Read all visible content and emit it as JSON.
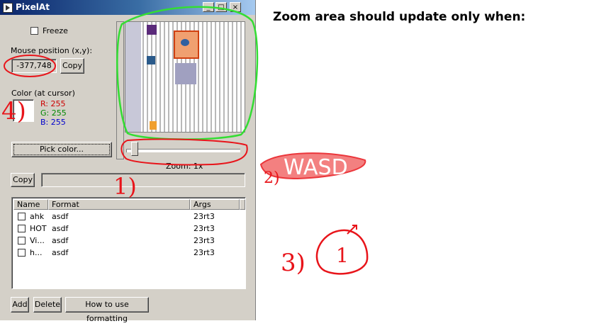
{
  "window": {
    "title": "PixelAt",
    "minimize": "_",
    "maximize": "□",
    "close": "×"
  },
  "freeze_label": "Freeze",
  "mouse_position": {
    "label": "Mouse position (x,y):",
    "value": "-377,748",
    "copy_label": "Copy"
  },
  "color": {
    "label": "Color (at cursor)",
    "r": "R: 255",
    "g": "G: 255",
    "b": "B: 255",
    "swatch": "#ffffff",
    "r_color": "#cc0000",
    "g_color": "#008800",
    "b_color": "#0000cc"
  },
  "pick_color_label": "Pick color...",
  "zoom": {
    "label": "Zoom: 1x"
  },
  "copy_label_2": "Copy",
  "list": {
    "columns": [
      "Name",
      "Format",
      "Args"
    ],
    "rows": [
      {
        "name": "ahk",
        "format": "asdf",
        "args": "23rt3"
      },
      {
        "name": "HOT",
        "format": "asdf",
        "args": "23rt3"
      },
      {
        "name": "Vi...",
        "format": "asdf",
        "args": "23rt3"
      },
      {
        "name": "h...",
        "format": "asdf",
        "args": "23rt3"
      }
    ]
  },
  "buttons": {
    "add": "Add",
    "delete": "Delete",
    "how_to": "How to use formatting"
  },
  "annotation": {
    "note": "Zoom area should update only when:",
    "mark_4": "4)",
    "mark_1": "1)",
    "mark_2": "2)",
    "wasd": "WASD",
    "mark_3": "3)",
    "circle_1": "1",
    "ink_red": "#e8141a",
    "ink_green": "#33dd33"
  }
}
